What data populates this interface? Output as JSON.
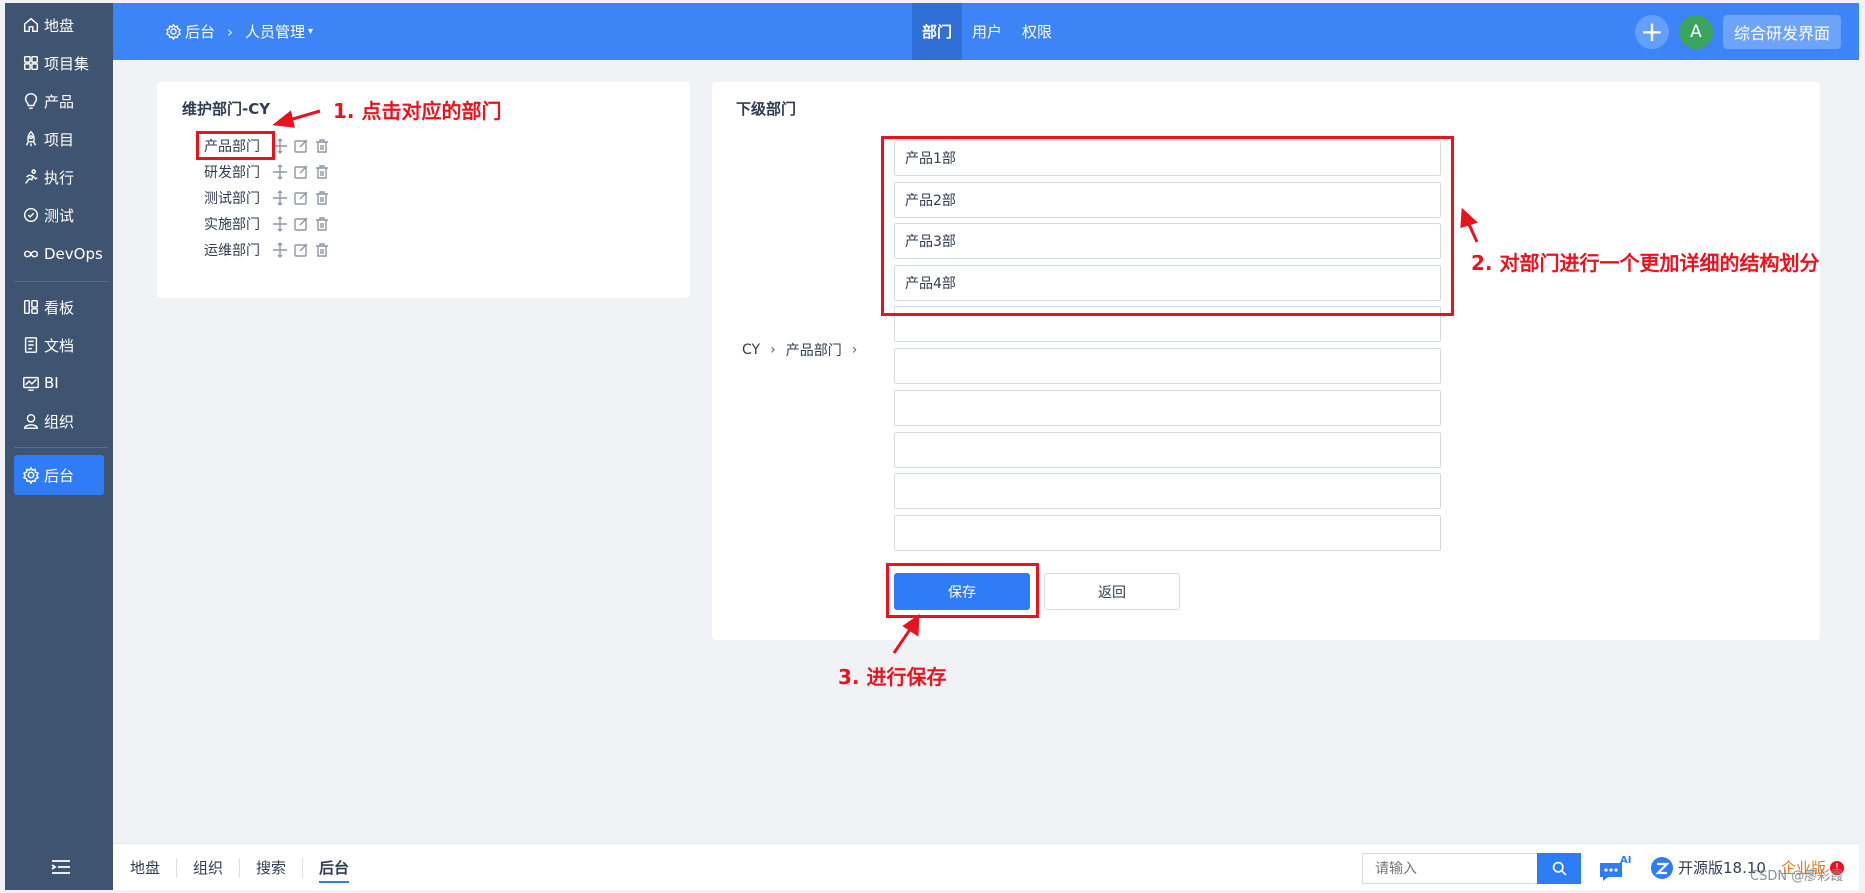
{
  "sidebar": {
    "items": [
      {
        "label": "地盘",
        "icon": "home-icon"
      },
      {
        "label": "项目集",
        "icon": "grid-icon"
      },
      {
        "label": "产品",
        "icon": "lightbulb-icon"
      },
      {
        "label": "项目",
        "icon": "rocket-icon"
      },
      {
        "label": "执行",
        "icon": "run-icon"
      },
      {
        "label": "测试",
        "icon": "test-icon"
      },
      {
        "label": "DevOps",
        "icon": "infinity-icon"
      },
      {
        "label": "看板",
        "icon": "kanban-icon"
      },
      {
        "label": "文档",
        "icon": "document-icon"
      },
      {
        "label": "BI",
        "icon": "chart-icon"
      },
      {
        "label": "组织",
        "icon": "user-icon"
      },
      {
        "label": "后台",
        "icon": "gear-icon",
        "active": true
      }
    ]
  },
  "header": {
    "breadcrumb_home": "后台",
    "breadcrumb_current": "人员管理",
    "tabs": [
      "部门",
      "用户",
      "权限"
    ],
    "active_tab": "部门",
    "avatar_letter": "A",
    "plus_symbol": "+",
    "workspace": "综合研发界面",
    "accent_color": "#3d84f7"
  },
  "left_panel": {
    "title": "维护部门-CY",
    "departments": [
      "产品部门",
      "研发部门",
      "测试部门",
      "实施部门",
      "运维部门"
    ]
  },
  "right_panel": {
    "title": "下级部门",
    "path_root": "CY",
    "path_current": "产品部门",
    "sub_departments": [
      "产品1部",
      "产品2部",
      "产品3部",
      "产品4部",
      "",
      "",
      "",
      "",
      "",
      ""
    ],
    "save_label": "保存",
    "back_label": "返回"
  },
  "annotations": {
    "step1": "1. 点击对应的部门",
    "step2": "2. 对部门进行一个更加详细的结构划分",
    "step3": "3. 进行保存",
    "color": "#e8131f"
  },
  "footer": {
    "tabs": [
      "地盘",
      "组织",
      "搜索",
      "后台"
    ],
    "active_tab": "后台",
    "search_placeholder": "请输入",
    "ai_badge": "AI",
    "version": "开源版18.10",
    "enterprise": "企业版",
    "enterprise_badge": "!"
  },
  "watermark": "CSDN @廖彩霞"
}
